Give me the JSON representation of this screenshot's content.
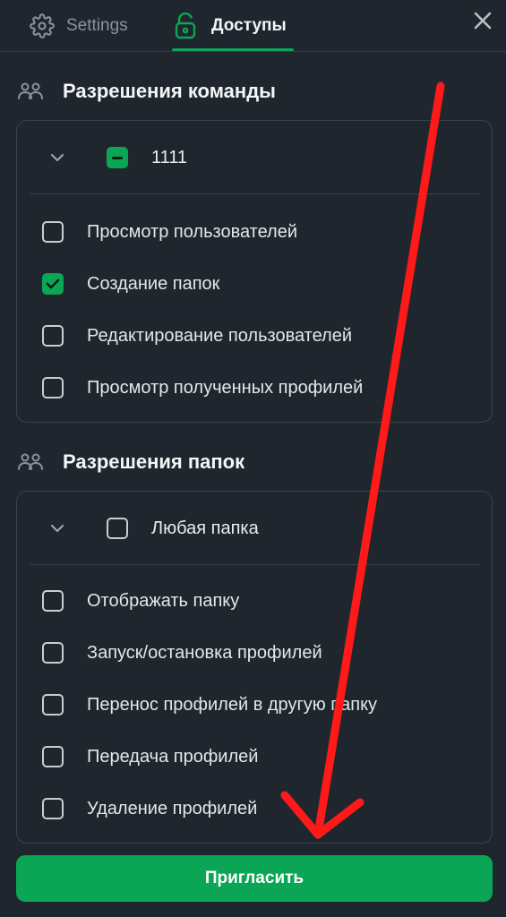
{
  "tabs": {
    "settings_label": "Settings",
    "access_label": "Доступы",
    "active": "access"
  },
  "team_section": {
    "title": "Разрешения команды",
    "group": {
      "label": "1111",
      "state": "indeterminate"
    },
    "permissions": [
      {
        "label": "Просмотр пользователей",
        "checked": false
      },
      {
        "label": "Создание папок",
        "checked": true
      },
      {
        "label": "Редактирование пользователей",
        "checked": false
      },
      {
        "label": "Просмотр полученных профилей",
        "checked": false
      }
    ]
  },
  "folder_section": {
    "title": "Разрешения папок",
    "group": {
      "label": "Любая папка",
      "state": "unchecked"
    },
    "permissions": [
      {
        "label": "Отображать папку",
        "checked": false
      },
      {
        "label": "Запуск/остановка профилей",
        "checked": false
      },
      {
        "label": "Перенос профилей в другую папку",
        "checked": false
      },
      {
        "label": "Передача профилей",
        "checked": false
      },
      {
        "label": "Удаление профилей",
        "checked": false
      }
    ]
  },
  "invite_button_label": "Пригласить",
  "icons": {
    "settings": "gear-icon",
    "access": "lock-icon",
    "close": "close-icon",
    "section": "users-icon",
    "expand": "chevron-down-icon"
  },
  "colors": {
    "background": "#20262d",
    "accent": "#0aa656",
    "annotation": "#ff1a1a"
  }
}
